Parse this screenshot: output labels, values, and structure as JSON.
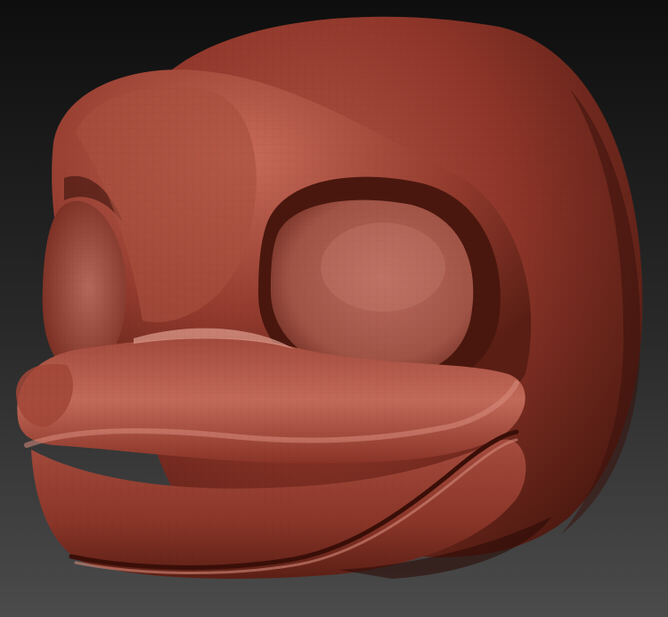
{
  "scene": {
    "subject": "sculpted-cartoon-duck-head",
    "colors": {
      "background_top": "#0e0e0e",
      "background_bottom": "#4b4b4b",
      "clay_base": "#8c3428",
      "clay_light": "#c86a5a",
      "clay_shadow": "#3e140e",
      "clay_highlight": "#e7a593"
    }
  }
}
